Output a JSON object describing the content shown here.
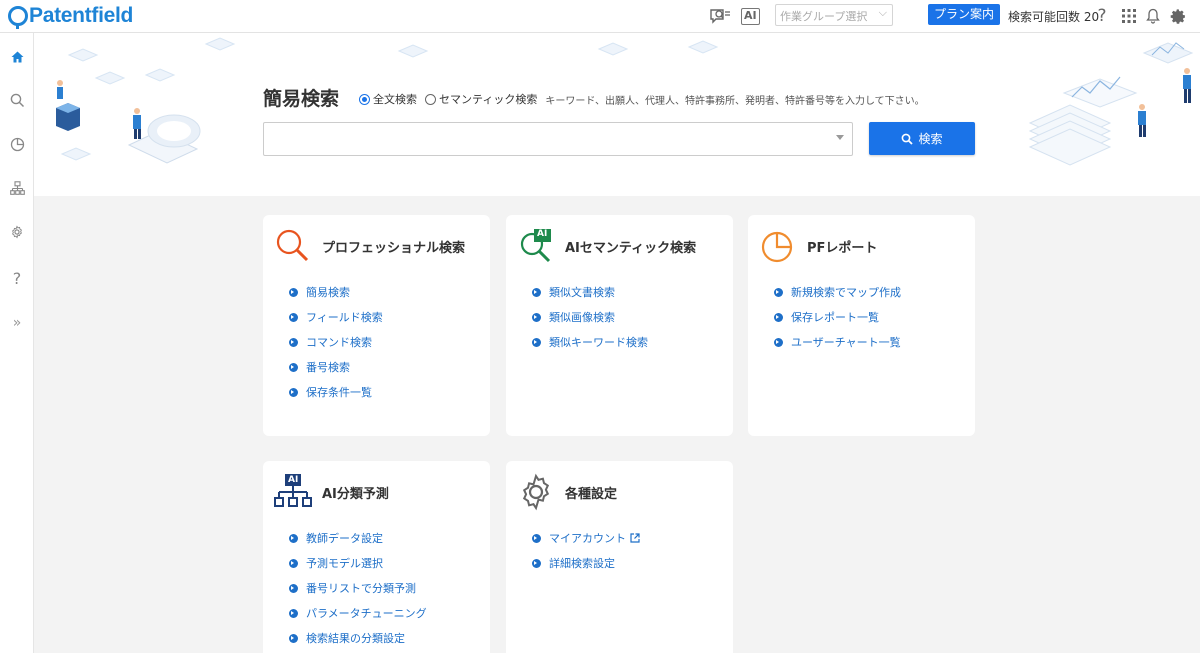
{
  "header": {
    "logo": "Patentfield",
    "ai_label": "AI",
    "group_select_placeholder": "作業グループ選択",
    "plan_button": "プラン案内",
    "quota_text": "検索可能回数 20"
  },
  "sidebar": {
    "items": [
      "home-icon",
      "search-icon",
      "chart-icon",
      "hierarchy-icon",
      "gear-icon",
      "help-icon",
      "expand-icon"
    ]
  },
  "hero": {
    "title": "簡易検索",
    "radio_fulltext": "全文検索",
    "radio_semantic": "セマンティック検索",
    "hint": "キーワード、出願人、代理人、特許事務所、発明者、特許番号等を入力して下さい。",
    "search_value": "",
    "search_button": "検索"
  },
  "cards": {
    "professional": {
      "title": "プロフェッショナル検索",
      "links": [
        "簡易検索",
        "フィールド検索",
        "コマンド検索",
        "番号検索",
        "保存条件一覧"
      ]
    },
    "ai_semantic": {
      "title": "AIセマンティック検索",
      "badge": "AI",
      "links": [
        "類似文書検索",
        "類似画像検索",
        "類似キーワード検索"
      ]
    },
    "pf_report": {
      "title": "PFレポート",
      "links": [
        "新規検索でマップ作成",
        "保存レポート一覧",
        "ユーザーチャート一覧"
      ]
    },
    "ai_classification": {
      "title": "AI分類予測",
      "badge": "AI",
      "links": [
        "教師データ設定",
        "予測モデル選択",
        "番号リストで分類予測",
        "パラメータチューニング",
        "検索結果の分類設定"
      ]
    },
    "settings": {
      "title": "各種設定",
      "links": [
        "マイアカウント",
        "詳細検索設定"
      ]
    }
  },
  "colors": {
    "brand": "#1e84d6",
    "primary_button": "#1a73e8",
    "link": "#1e6fc8",
    "search_icon_orange": "#e8541f",
    "ai_green": "#1e8a4c",
    "report_orange": "#f08c2e",
    "ai_navy": "#1e3f7a"
  }
}
